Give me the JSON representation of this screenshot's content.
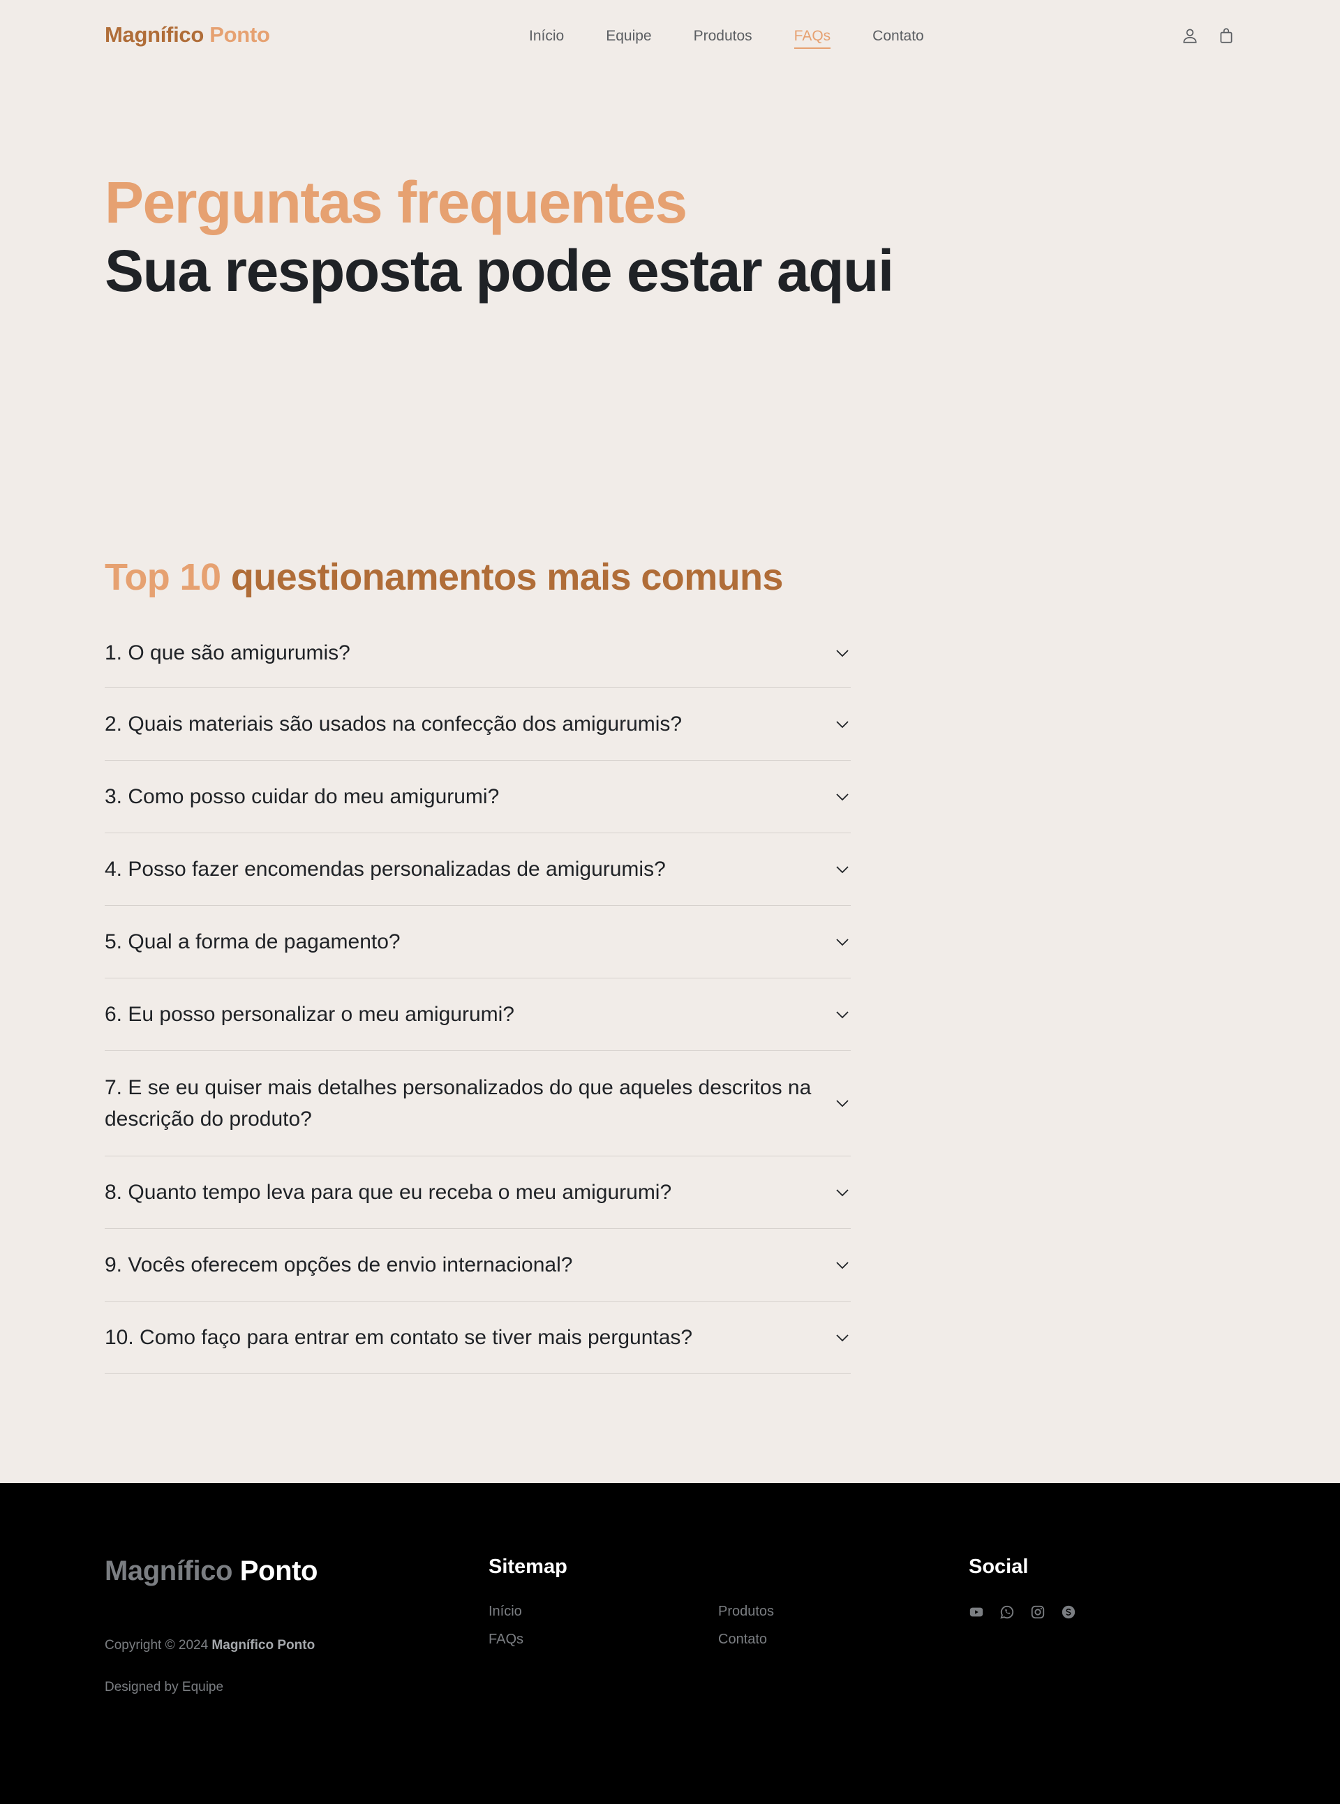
{
  "header": {
    "brand_part1": "Magnífico",
    "brand_part2": "Ponto",
    "nav": [
      {
        "label": "Início"
      },
      {
        "label": "Equipe"
      },
      {
        "label": "Produtos"
      },
      {
        "label": "FAQs",
        "active": true
      },
      {
        "label": "Contato"
      }
    ],
    "icons": [
      "user-icon",
      "shopping-bag-icon"
    ]
  },
  "hero": {
    "eyebrow": "Perguntas frequentes",
    "title": "Sua resposta pode estar aqui"
  },
  "faq": {
    "heading_part1": "Top 10",
    "heading_part2": "questionamentos mais comuns",
    "items": [
      {
        "question": "1. O que são amigurumis?"
      },
      {
        "question": "2. Quais materiais são usados na confecção dos amigurumis?"
      },
      {
        "question": "3. Como posso cuidar do meu amigurumi?"
      },
      {
        "question": "4. Posso fazer encomendas personalizadas de amigurumis?"
      },
      {
        "question": "5. Qual a forma de pagamento?"
      },
      {
        "question": "6. Eu posso personalizar o meu amigurumi?"
      },
      {
        "question": "7. E se eu quiser mais detalhes personalizados do que aqueles descritos na descrição do produto?"
      },
      {
        "question": "8. Quanto tempo leva para que eu receba o meu amigurumi?"
      },
      {
        "question": "9. Vocês oferecem opções de envio internacional?"
      },
      {
        "question": "10. Como faço para entrar em contato se tiver mais perguntas?"
      }
    ],
    "toggle_icon": "chevron-down-icon"
  },
  "footer": {
    "brand_part1": "Magnífico",
    "brand_part2": "Ponto",
    "copyright_prefix": "Copyright © 2024",
    "copyright_brand": "Magnífico Ponto",
    "designed_by": "Designed by Equipe",
    "sitemap_title": "Sitemap",
    "sitemap_links": [
      {
        "label": "Início"
      },
      {
        "label": "FAQs"
      },
      {
        "label": "Produtos"
      },
      {
        "label": "Contato"
      }
    ],
    "social_title": "Social",
    "social_icons": [
      "youtube-icon",
      "whatsapp-icon",
      "instagram-icon",
      "skype-icon"
    ]
  },
  "colors": {
    "background": "#f1ece8",
    "accent_light": "#e6a171",
    "accent_dark": "#b06d38",
    "text": "#1f2226",
    "footer_bg": "#000000"
  }
}
